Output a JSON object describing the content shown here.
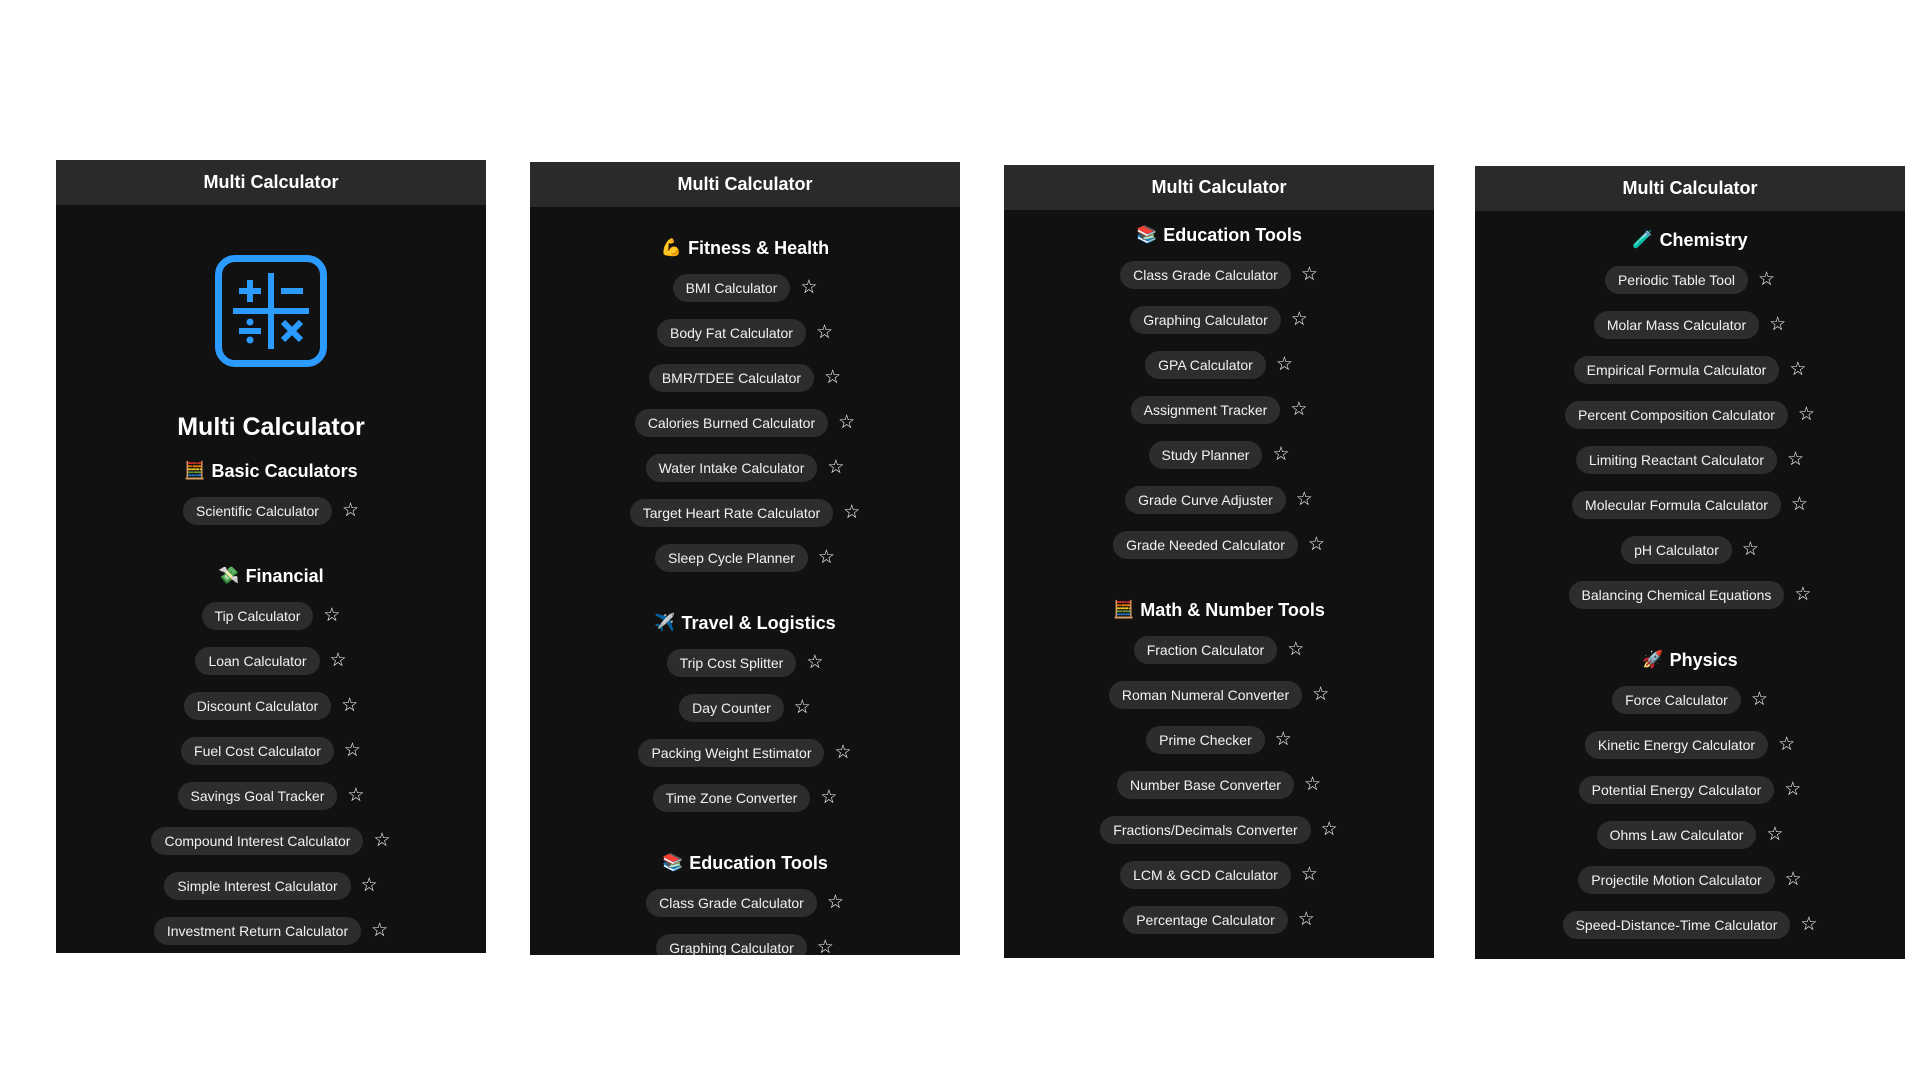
{
  "screens": [
    {
      "title": "Multi Calculator",
      "heading": "Multi Calculator",
      "sections": [
        {
          "emoji": "🧮",
          "title": "Basic Caculators",
          "items": [
            "Scientific Calculator"
          ]
        },
        {
          "emoji": "💸",
          "title": "Financial",
          "items": [
            "Tip Calculator",
            "Loan Calculator",
            "Discount Calculator",
            "Fuel Cost Calculator",
            "Savings Goal Tracker",
            "Compound Interest Calculator",
            "Simple Interest Calculator",
            "Investment Return Calculator"
          ]
        }
      ]
    },
    {
      "title": "Multi Calculator",
      "sections": [
        {
          "emoji": "💪",
          "title": "Fitness & Health",
          "items": [
            "BMI Calculator",
            "Body Fat Calculator",
            "BMR/TDEE Calculator",
            "Calories Burned Calculator",
            "Water Intake Calculator",
            "Target Heart Rate Calculator",
            "Sleep Cycle Planner"
          ]
        },
        {
          "emoji": "✈️",
          "title": "Travel & Logistics",
          "items": [
            "Trip Cost Splitter",
            "Day Counter",
            "Packing Weight Estimator",
            "Time Zone Converter"
          ]
        },
        {
          "emoji": "📚",
          "title": "Education Tools",
          "items": [
            "Class Grade Calculator",
            "Graphing Calculator"
          ]
        }
      ]
    },
    {
      "title": "Multi Calculator",
      "sections": [
        {
          "emoji": "📚",
          "title": "Education Tools",
          "items": [
            "Class Grade Calculator",
            "Graphing Calculator",
            "GPA Calculator",
            "Assignment Tracker",
            "Study Planner",
            "Grade Curve Adjuster",
            "Grade Needed Calculator"
          ]
        },
        {
          "emoji": "🧮",
          "title": "Math & Number Tools",
          "items": [
            "Fraction Calculator",
            "Roman Numeral Converter",
            "Prime Checker",
            "Number Base Converter",
            "Fractions/Decimals Converter",
            "LCM & GCD Calculator",
            "Percentage Calculator"
          ]
        }
      ]
    },
    {
      "title": "Multi Calculator",
      "sections": [
        {
          "emoji": "🧪",
          "title": "Chemistry",
          "items": [
            "Periodic Table Tool",
            "Molar Mass Calculator",
            "Empirical Formula Calculator",
            "Percent Composition Calculator",
            "Limiting Reactant Calculator",
            "Molecular Formula Calculator",
            "pH Calculator",
            "Balancing Chemical Equations"
          ]
        },
        {
          "emoji": "🚀",
          "title": "Physics",
          "items": [
            "Force Calculator",
            "Kinetic Energy Calculator",
            "Potential Energy Calculator",
            "Ohms Law Calculator",
            "Projectile Motion Calculator",
            "Speed-Distance-Time Calculator"
          ]
        }
      ]
    }
  ],
  "icons": {
    "favorite": "star-outline-icon",
    "app": "calculator-icon"
  },
  "colors": {
    "background": "#111111",
    "appbar": "#2a2a2c",
    "pill": "#2d2d2d",
    "accent": "#2b9bff"
  }
}
